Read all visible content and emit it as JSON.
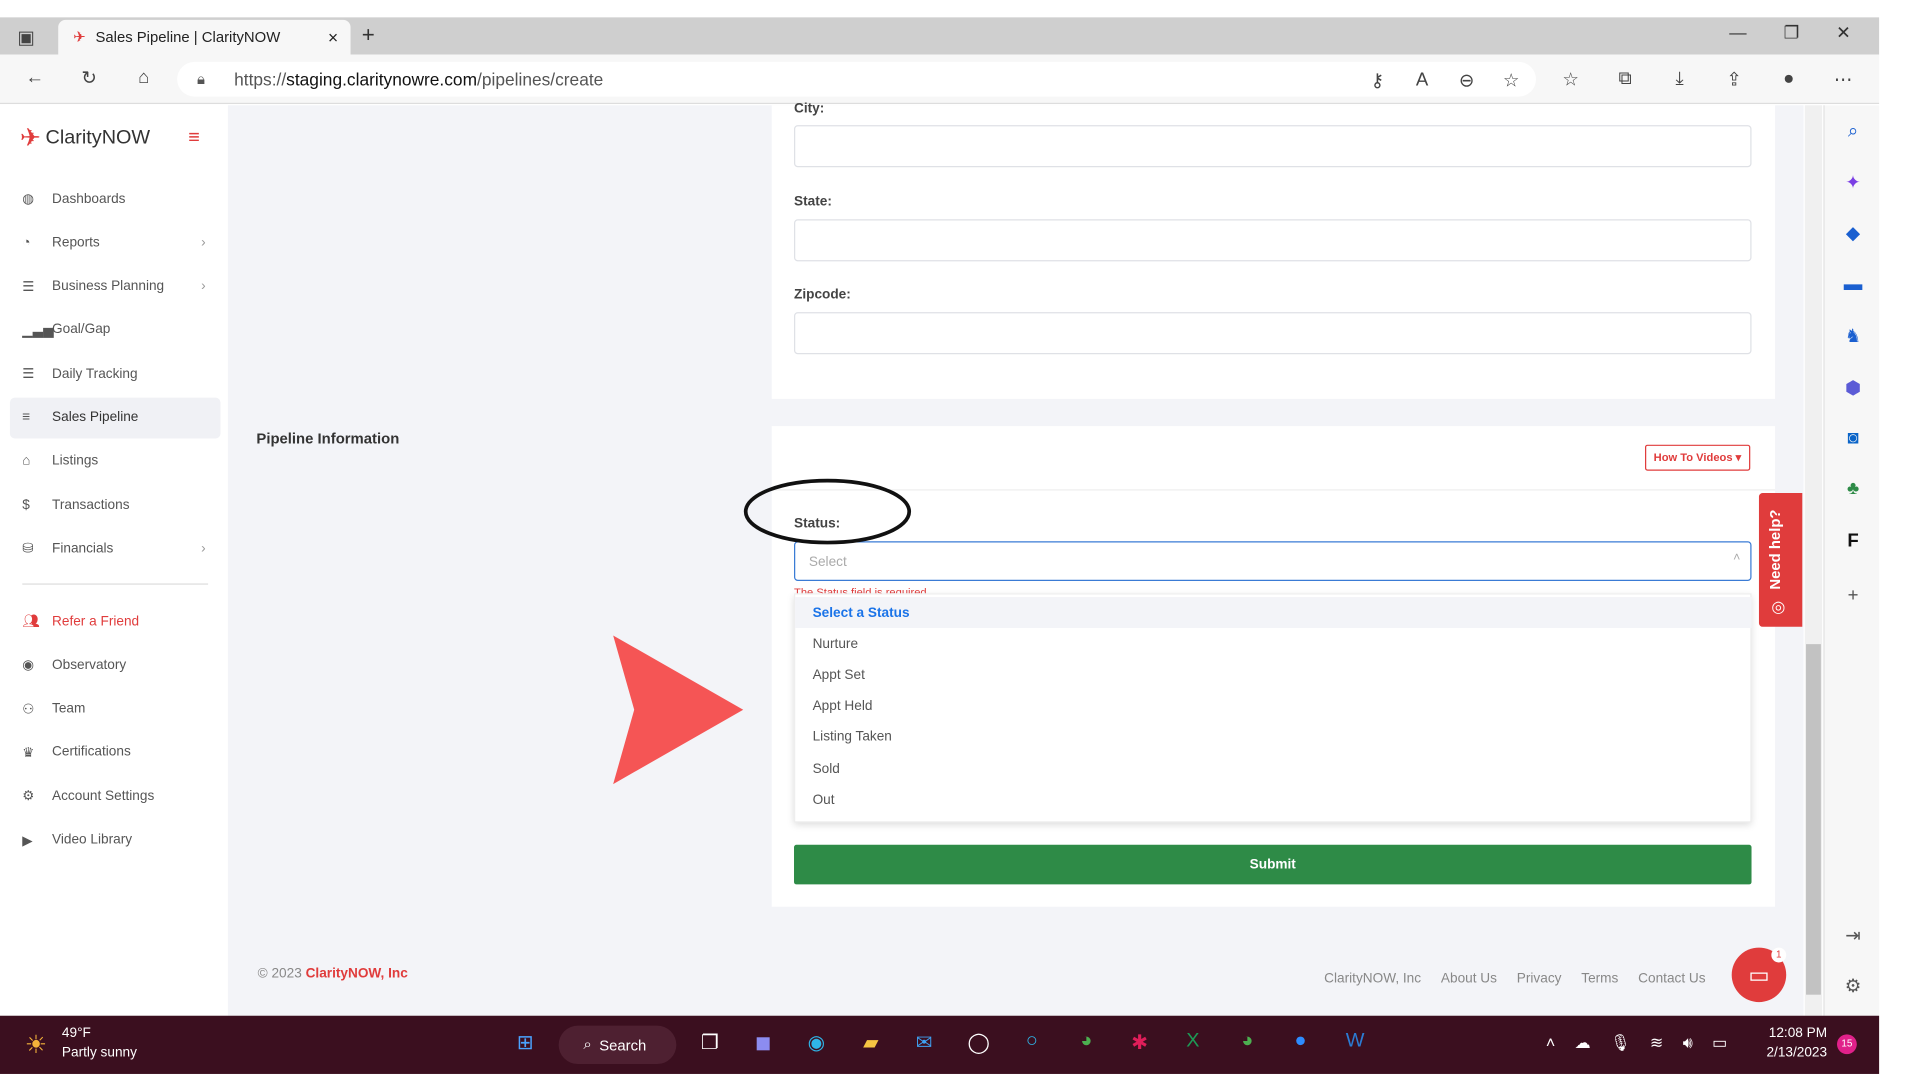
{
  "browser": {
    "tab_title": "Sales Pipeline | ClarityNOW",
    "url_prefix": "https://",
    "url_host": "staging.claritynowre.com",
    "url_path": "/pipelines/create"
  },
  "brand": {
    "name": "ClarityNOW",
    "accent": "#e03c3c"
  },
  "sidebar": {
    "items": [
      {
        "label": "Dashboards",
        "icon": "dashboard-icon",
        "chev": false
      },
      {
        "label": "Reports",
        "icon": "pie-chart-icon",
        "chev": true
      },
      {
        "label": "Business Planning",
        "icon": "list-icon",
        "chev": true
      },
      {
        "label": "Goal/Gap",
        "icon": "bar-signal-icon",
        "chev": false
      },
      {
        "label": "Daily Tracking",
        "icon": "list-icon",
        "chev": false
      },
      {
        "label": "Sales Pipeline",
        "icon": "menu-icon",
        "chev": false,
        "active": true
      },
      {
        "label": "Listings",
        "icon": "home-icon",
        "chev": false
      },
      {
        "label": "Transactions",
        "icon": "dollar-icon",
        "chev": false
      },
      {
        "label": "Financials",
        "icon": "coins-icon",
        "chev": true
      }
    ],
    "items2": [
      {
        "label": "Refer a Friend",
        "icon": "users-icon",
        "red": true
      },
      {
        "label": "Observatory",
        "icon": "eye-icon"
      },
      {
        "label": "Team",
        "icon": "team-icon"
      },
      {
        "label": "Certifications",
        "icon": "crown-icon"
      },
      {
        "label": "Account Settings",
        "icon": "gear-icon"
      },
      {
        "label": "Video Library",
        "icon": "play-icon"
      }
    ]
  },
  "form": {
    "city_label": "City:",
    "state_label": "State:",
    "zipcode_label": "Zipcode:",
    "section_title": "Pipeline Information",
    "how_to_videos": "How To Videos",
    "status_label": "Status:",
    "status_placeholder": "Select",
    "status_error": "The Status field is required.",
    "options": [
      "Select a Status",
      "Nurture",
      "Appt Set",
      "Appt Held",
      "Listing Taken",
      "Sold",
      "Out"
    ],
    "submit": "Submit"
  },
  "need_help": "Need help?",
  "footer": {
    "copyright": "© 2023",
    "company": "ClarityNOW, Inc",
    "links": [
      "ClarityNOW, Inc",
      "About Us",
      "Privacy",
      "Terms",
      "Contact Us"
    ]
  },
  "chat_badge": "1",
  "taskbar": {
    "temp": "49°F",
    "weather": "Partly sunny",
    "search": "Search",
    "time": "12:08 PM",
    "date": "2/13/2023",
    "notif": "15"
  }
}
